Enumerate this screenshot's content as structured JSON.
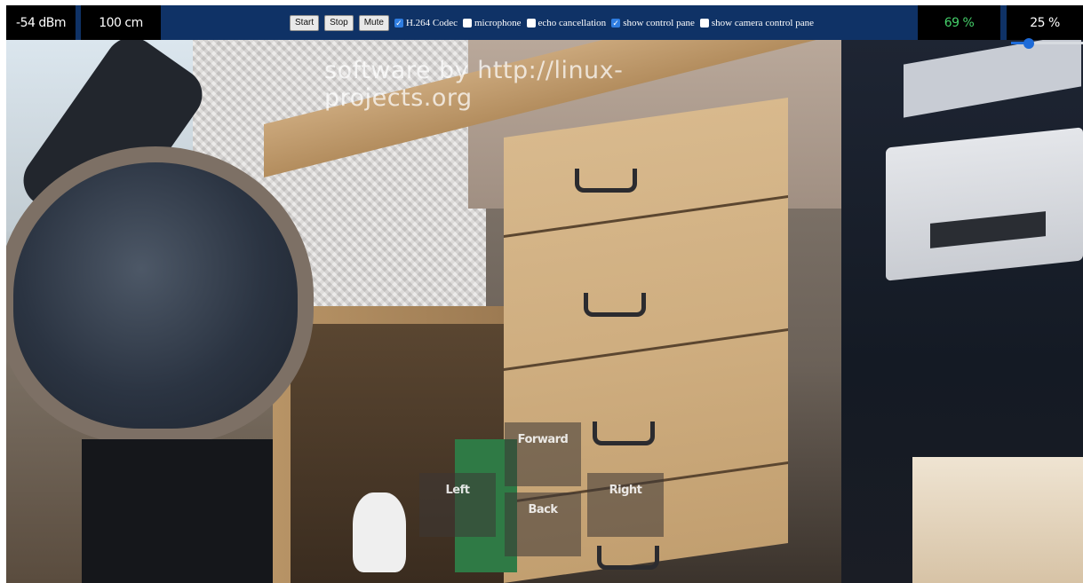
{
  "status": {
    "signal": "-54 dBm",
    "distance": "100 cm",
    "battery": "69 %",
    "volume": "25 %"
  },
  "controls": {
    "buttons": [
      "Start",
      "Stop",
      "Mute"
    ],
    "options": [
      {
        "label": "H.264 Codec",
        "checked": true
      },
      {
        "label": "microphone",
        "checked": false
      },
      {
        "label": "echo cancellation",
        "checked": false
      },
      {
        "label": "show control pane",
        "checked": true
      },
      {
        "label": "show camera control pane",
        "checked": false
      }
    ]
  },
  "volume_slider": {
    "value": 0.25
  },
  "watermark": "software by http://linux-projects.org",
  "drive_pad": {
    "forward": "Forward",
    "left": "Left",
    "back": "Back",
    "right": "Right"
  },
  "colors": {
    "bar_bg": "#0f3266",
    "battery_text": "#45d06a",
    "accent": "#1e6bd8"
  }
}
